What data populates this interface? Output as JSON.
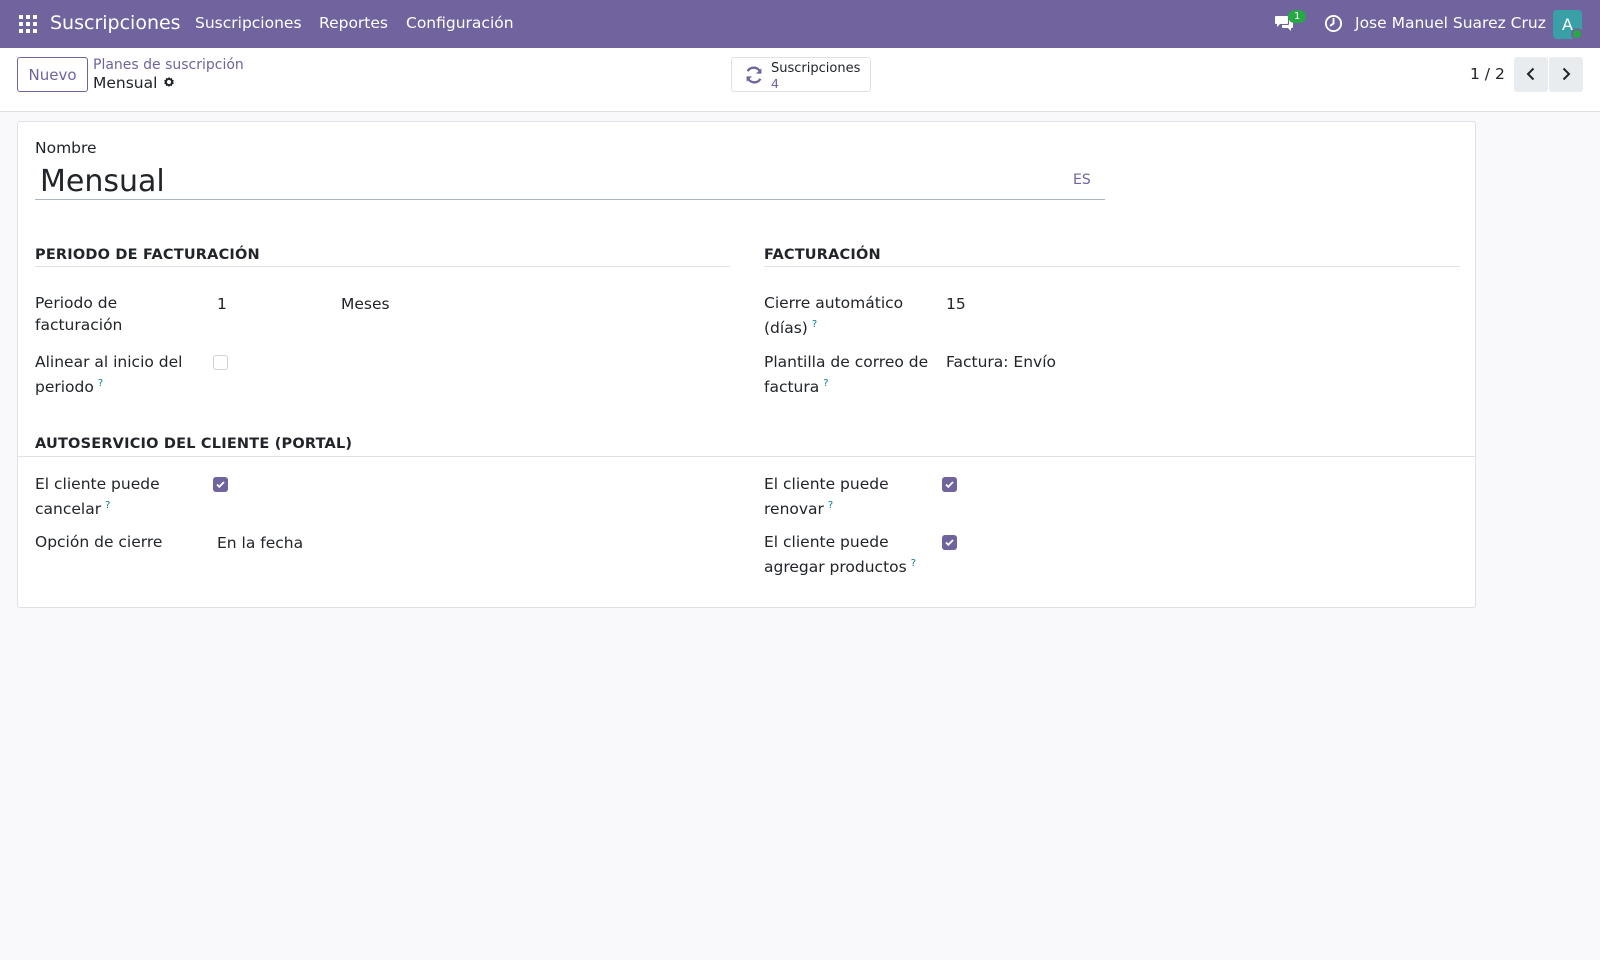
{
  "navbar": {
    "app_name": "Suscripciones",
    "menu": [
      "Suscripciones",
      "Reportes",
      "Configuración"
    ],
    "messages_count": "1",
    "user_name": "Jose Manuel Suarez Cruz",
    "avatar_letter": "A",
    "bg_color": "#71639e"
  },
  "control_panel": {
    "new_button": "Nuevo",
    "breadcrumb_parent": "Planes de suscripción",
    "breadcrumb_current": "Mensual",
    "smart_button": {
      "label": "Suscripciones",
      "count": "4",
      "icon": "refresh-icon"
    },
    "pager": "1 / 2"
  },
  "form": {
    "name_label": "Nombre",
    "name_value": "Mensual",
    "lang": "ES",
    "billing_period_section": "PERIODO DE FACTURACIÓN",
    "billing_section": "FACTURACIÓN",
    "portal_section": "AUTOSERVICIO DEL CLIENTE (PORTAL)",
    "fields": {
      "billing_period": {
        "label_1": "Periodo de",
        "label_2": "facturación",
        "value": "1",
        "unit": "Meses"
      },
      "align_start": {
        "label_1": "Alinear al inicio del",
        "label_2": "periodo",
        "checked": false
      },
      "auto_close": {
        "label_1": "Cierre automático",
        "label_2": "(días)",
        "value": "15"
      },
      "invoice_mail_template": {
        "label_1": "Plantilla de correo de",
        "label_2": "factura",
        "value": "Factura: Envío"
      },
      "customer_can_cancel": {
        "label_1": "El cliente puede",
        "label_2": "cancelar",
        "checked": true
      },
      "closing_option": {
        "label": "Opción de cierre",
        "value": "En la fecha"
      },
      "customer_can_renew": {
        "label_1": "El cliente puede",
        "label_2": "renovar",
        "checked": true
      },
      "customer_can_add_products": {
        "label_1": "El cliente puede",
        "label_2": "agregar productos",
        "checked": true
      }
    },
    "help_mark": "?"
  }
}
